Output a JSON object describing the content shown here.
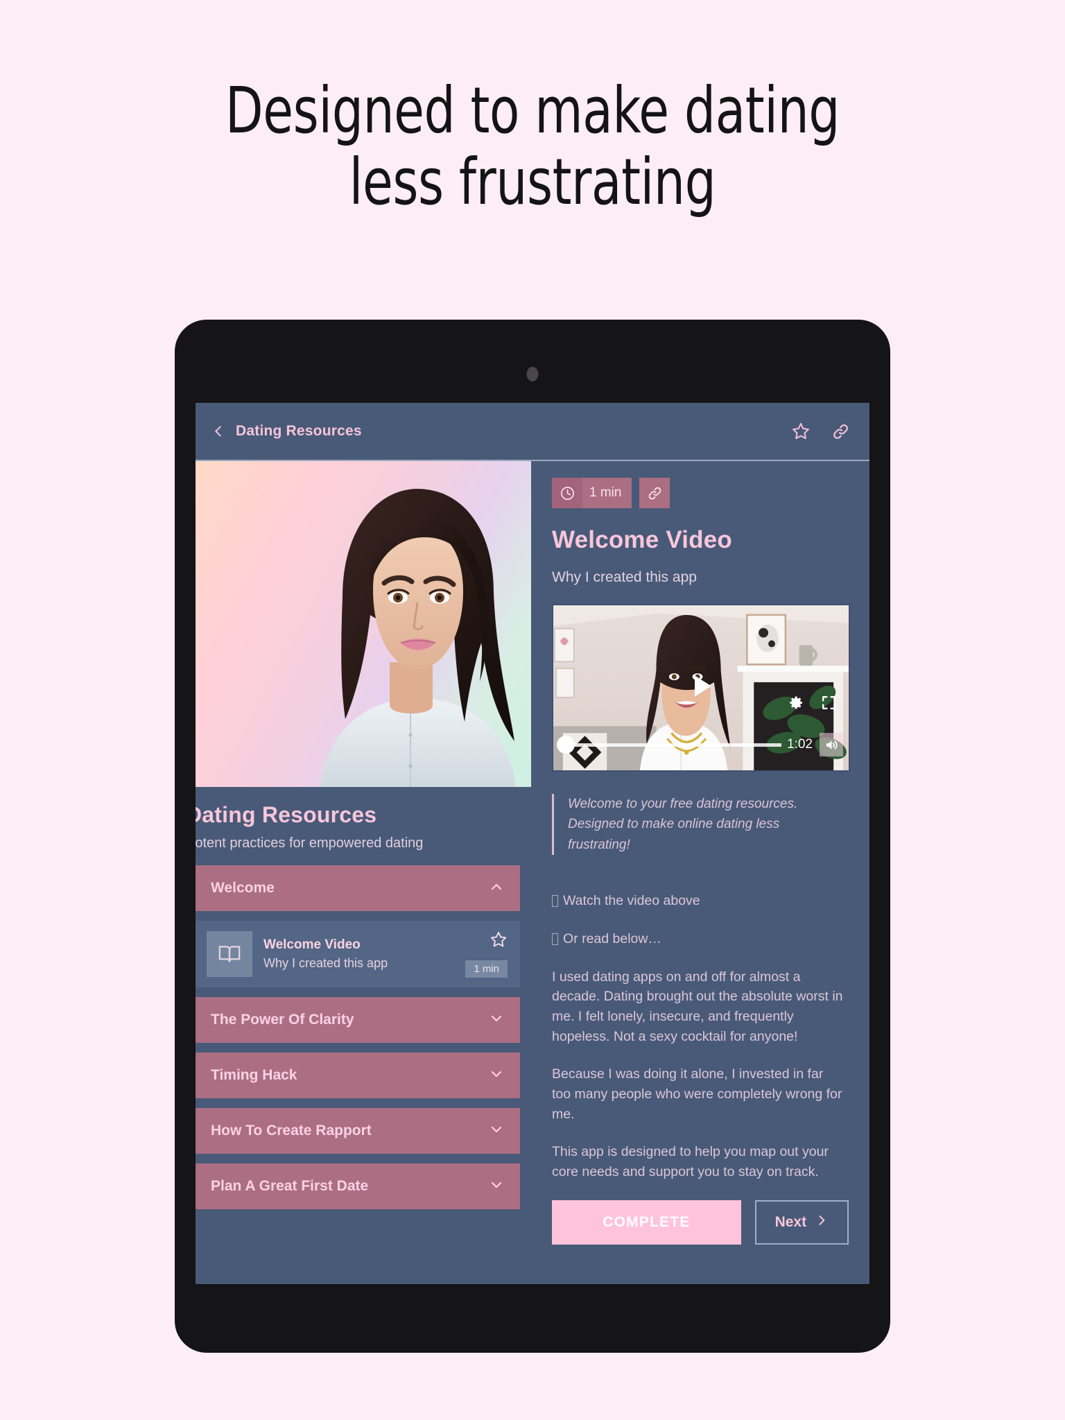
{
  "headline": {
    "line1": "Designed to make dating",
    "line2": "less frustrating"
  },
  "colors": {
    "page_bg": "#fdeef5",
    "screen_bg": "#485a78",
    "accent_pink": "#f8c6da",
    "accordion_rose": "#ac6e82",
    "complete_pink": "#ffc3dc",
    "device_black": "#151416"
  },
  "appbar": {
    "back_icon": "chevron-left-icon",
    "title": "Dating Resources",
    "actions": [
      {
        "icon": "star-outline-icon",
        "name": "favorite-button"
      },
      {
        "icon": "link-icon",
        "name": "share-link-button"
      }
    ]
  },
  "sidebar": {
    "title": "Dating Resources",
    "subtitle": "Potent practices for empowered dating",
    "hero_image_alt": "portrait-photo",
    "sections": [
      {
        "label": "Welcome",
        "expanded": true,
        "chevron": "chevron-up-icon",
        "lessons": [
          {
            "icon": "book-open-icon",
            "title": "Welcome Video",
            "subtitle": "Why I created this app",
            "star": "star-outline-icon",
            "duration": "1 min"
          }
        ]
      },
      {
        "label": "The Power Of Clarity",
        "expanded": false,
        "chevron": "chevron-down-icon",
        "lessons": []
      },
      {
        "label": "Timing Hack",
        "expanded": false,
        "chevron": "chevron-down-icon",
        "lessons": []
      },
      {
        "label": "How To Create Rapport",
        "expanded": false,
        "chevron": "chevron-down-icon",
        "lessons": []
      },
      {
        "label": "Plan A Great First Date",
        "expanded": false,
        "chevron": "chevron-down-icon",
        "lessons": []
      }
    ]
  },
  "content": {
    "badges": {
      "clock_icon": "clock-icon",
      "duration": "1 min",
      "link_icon": "link-icon"
    },
    "title": "Welcome Video",
    "subtitle": "Why I created this app",
    "video": {
      "play_icon": "play-icon",
      "settings_icon": "gear-icon",
      "fullscreen_icon": "fullscreen-icon",
      "volume_icon": "volume-icon",
      "time": "1:02",
      "progress_percent": 0
    },
    "quote": "Welcome to your free dating resources. Designed to make online dating less frustrating!",
    "paragraphs": [
      {
        "bullet": true,
        "text": "Watch the video above"
      },
      {
        "bullet": true,
        "text": "Or read below…"
      },
      {
        "bullet": false,
        "text": "I used dating apps on and off for almost a decade. Dating brought out the absolute worst in me. I felt lonely, insecure, and frequently hopeless. Not a sexy cocktail for anyone!"
      },
      {
        "bullet": false,
        "text": "Because I was doing it alone, I invested in far too many people who were completely wrong for me."
      },
      {
        "bullet": false,
        "text": "This app is designed to help you map out your core needs and support you to stay on track."
      }
    ],
    "buttons": {
      "complete": "COMPLETE",
      "next": "Next",
      "next_icon": "chevron-right-icon"
    }
  }
}
